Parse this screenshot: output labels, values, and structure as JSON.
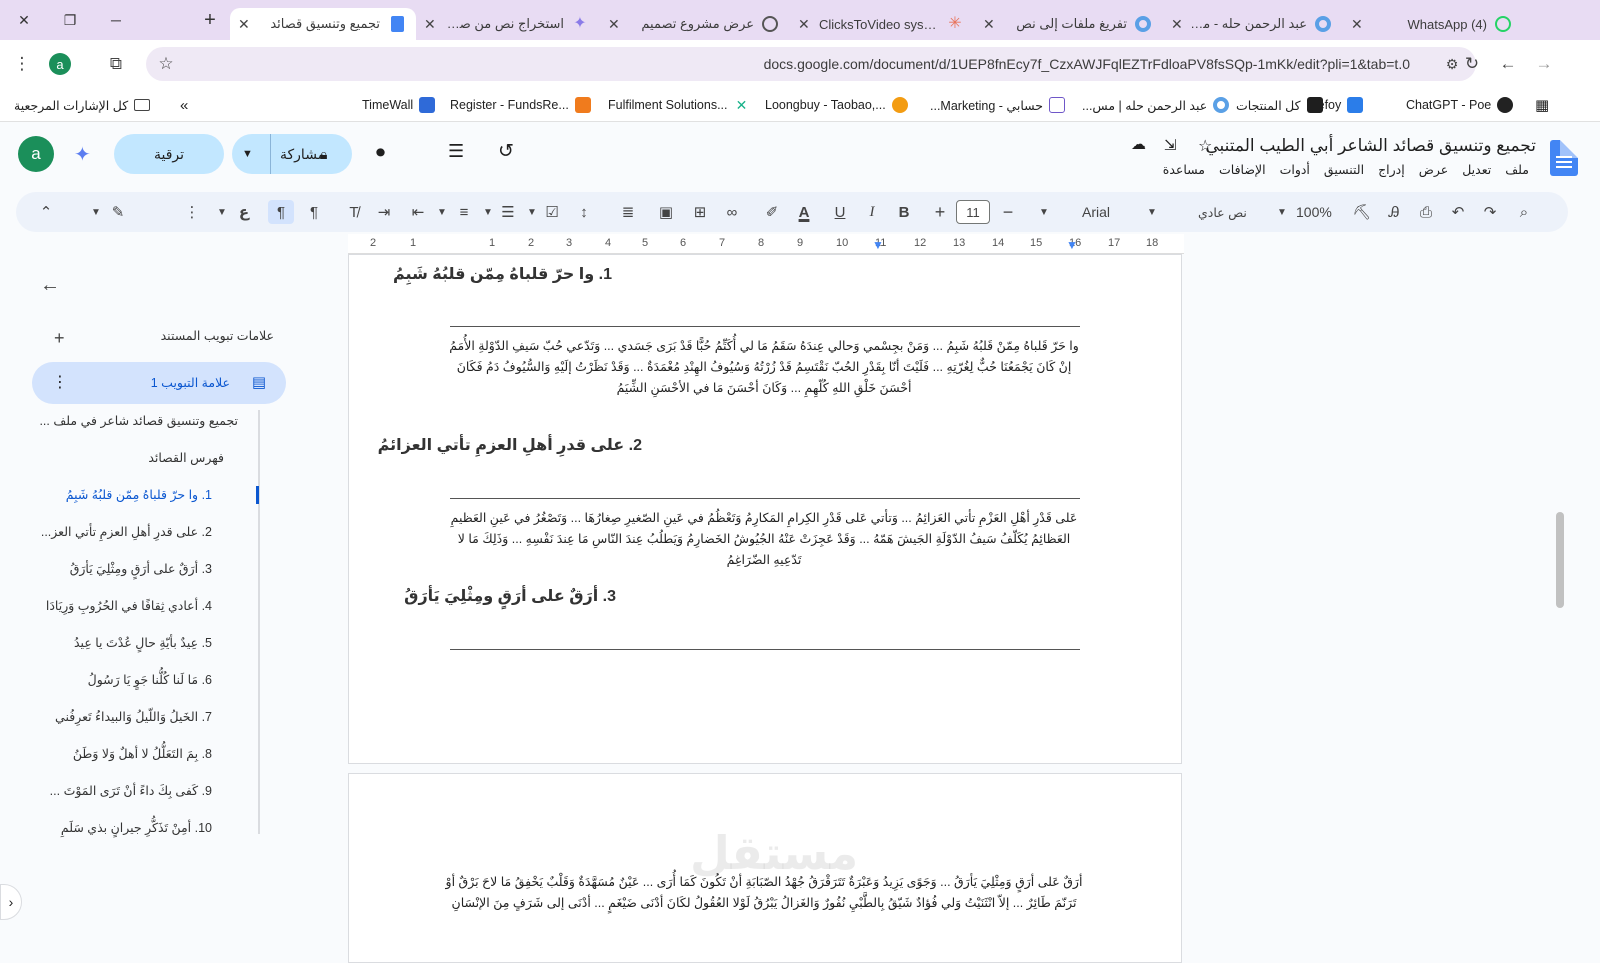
{
  "tabs": [
    {
      "label": "(4) WhatsApp",
      "active": false,
      "icon_color": "#25d366"
    },
    {
      "label": "عبد الرحمن حله - معرض",
      "active": false,
      "icon_color": "#5aa0e6"
    },
    {
      "label": "تفريغ ملفات إلى نص",
      "active": false,
      "icon_color": "#5aa0e6"
    },
    {
      "label": "ClicksToVideo system",
      "active": false,
      "icon_color": "#e8735a"
    },
    {
      "label": "عرض مشروع تصميم",
      "active": false,
      "icon_color": "#555555"
    },
    {
      "label": "استخراج نص من صفحة",
      "active": false,
      "icon_color": "#8a7be8"
    },
    {
      "label": "تجميع وتنسيق قصائد",
      "active": true,
      "icon_color": "#4285f4"
    }
  ],
  "browser": {
    "url": "docs.google.com/document/d/1UEP8fnEcy7f_CzxAWJFqlEZTrFdloaPV8fsSQp-1mKk/edit?pli=1&tab=t.0",
    "profile_initial": "a",
    "accent": "#6b3fa0"
  },
  "bookmarks": [
    {
      "label": "ChatGPT - Poe",
      "icon_color": "#222222"
    },
    {
      "label": "Zefoy",
      "icon_color": "#2b7de9"
    },
    {
      "label": "كل المنتجات",
      "icon_color": "#1e1e1e"
    },
    {
      "label": "عبد الرحمن حله | مس...",
      "icon_color": "#5aa0e6"
    },
    {
      "label": "حسابي - Marketing...",
      "icon_color": "#6f57c8"
    },
    {
      "label": "Loongbuy - Taobao,...",
      "icon_color": "#f39c12"
    },
    {
      "label": "Fulfilment Solutions...",
      "icon_color": "#19b28a"
    },
    {
      "label": "Register - FundsRe...",
      "icon_color": "#f07b1d"
    },
    {
      "label": "TimeWall",
      "icon_color": "#2f6ad8"
    }
  ],
  "bookmarks_all": "كل الإشارات المرجعية",
  "doc": {
    "title": "تجميع وتنسيق قصائد الشاعر أبي الطيب المتنبي",
    "menus": [
      "ملف",
      "تعديل",
      "عرض",
      "إدراج",
      "التنسيق",
      "أدوات",
      "الإضافات",
      "مساعدة"
    ],
    "share_label": "مشاركة",
    "upgrade_label": "ترقية",
    "user_initial": "a"
  },
  "toolbar": {
    "zoom": "100%",
    "style": "نص عادي",
    "font": "Arial",
    "font_size": "11"
  },
  "ruler_ticks": [
    "18",
    "17",
    "16",
    "15",
    "14",
    "13",
    "12",
    "11",
    "10",
    "9",
    "8",
    "7",
    "6",
    "5",
    "4",
    "3",
    "2",
    "1",
    "1",
    "2"
  ],
  "outline": {
    "section_title": "علامات تبويب المستند",
    "tab_name": "علامة التبويب 1",
    "items": [
      "تجميع وتنسيق قصائد شاعر في ملف ...",
      "فهرس القصائد",
      "1. وا حرّ قلباهُ مِمّن قلبُهُ شَبِمُ",
      "2. على قدرِ أهلِ العزمِ تأتي العز...",
      "3. أرَقٌ على أرَقٍ ومِثْلِيَ يَأرَقُ",
      "4. أعادي ثِقافًا في الحُرُوبِ وَرِيَادَا",
      "5. عِيدٌ بأيّةِ حالٍ عُدْتَ يا عِيدُ",
      "6. مَا لَنا كُلُّنا جَوٍ يَا رَسُولُ",
      "7. الخَيلُ وَاللّيلُ وَالبيداءُ تَعرِفُني",
      "8. بِمَ التَعَلُّلُ لا أهلٌ وَلا وَطَنُ",
      "9. كَفى بِكَ داءً أنْ تَرَى المَوْتَ ...",
      "10. أمِنْ تَذَكُّرِ جيرانٍ بذي سَلَمِ"
    ],
    "active_index": 2
  },
  "page": {
    "heading1": "1. وا حرّ قلباهُ مِمّن قلبُهُ شَبِمُ",
    "para1": "وا حَرّ قَلباهُ مِمّنْ قَلبُهُ شَبِمُ ... وَمَنْ بجِسْمي وَحالي عِندَهُ سَقَمُ مَا لي أُكَتِّمُ حُبًّا قَدْ بَرَى جَسَدي ... وَتَدّعي حُبّ سَيفِ الدّوْلةِ الأُمَمُ إنْ كَانَ يَجْمَعُنَا حُبٌّ لِغُرّتِهِ ... فَلَيْتَ أنّا بِقَدْرِ الحُبّ نَقْتَسِمُ قَدْ زُرْتُهُ وَسُيُوفُ الهِنْدِ مُغْمَدَةٌ ... وَقَدْ نَظَرْتُ إلَيْهِ وَالسُّيُوفُ دَمُ فَكَانَ أحْسَنَ خَلْقِ اللهِ كُلّهِمِ ... وَكَانَ أحْسَنَ مَا في الأحْسَنِ الشِّيَمُ",
    "heading2": "2. على قدرِ أهلِ العزمِ تأتي العزائمُ",
    "para2": "عَلى قَدْرِ أهْلِ العَزْمِ تأتي العَزائِمُ ... وَتأتي عَلى قَدْرِ الكِرامِ المَكارِمُ وَتَعْظُمُ في عَينِ الصّغيرِ صِغارُهَا ... وَتَصْغُرُ في عَينِ العَظيمِ العَظائِمُ يُكَلّفُ سَيفُ الدّوْلَةِ الجَيشَ هَمّهُ ... وَقَدْ عَجِزَتْ عَنْهُ الجُيُوشُ الخَضارِمُ وَيَطلُبُ عِندَ النّاسِ مَا عِندَ نَفْسِهِ ... وَذَلِكَ مَا لا تَدّعِيهِ الضّرَاغِمُ",
    "heading3": "3. أرَقٌ على أرَقٍ ومِثْلِيَ يَأرَقُ",
    "para3": "أرَقٌ عَلى أرَقٍ وَمِثْلِيَ يَأرَقُ ... وَجَوًى يَزِيدُ وَعَبْرَةٌ تَتَرَقْرَقُ جُهْدُ الصّبَابَةِ أنْ تَكُونَ كَمَا أُرَى ... عَيْنٌ مُسَهَّدَةٌ وَقَلْبٌ يَخْفِقُ مَا لاحَ بَرْقٌ أوْ تَرَنّمَ طَائِرٌ ... إلاّ انْثَنَيْتُ وَلي فُؤادٌ شَيّقُ بِالطَّبْيِ نُفُورٌ وَالغَزالُ يَبْرُقُ لَوْلا العُقُولُ لكَانَ أدْنَى ضَيْغَمٍ ... أدْنَى إلى شَرَفٍ مِنَ الإنْسَانِ"
  },
  "watermark": "مستقل"
}
